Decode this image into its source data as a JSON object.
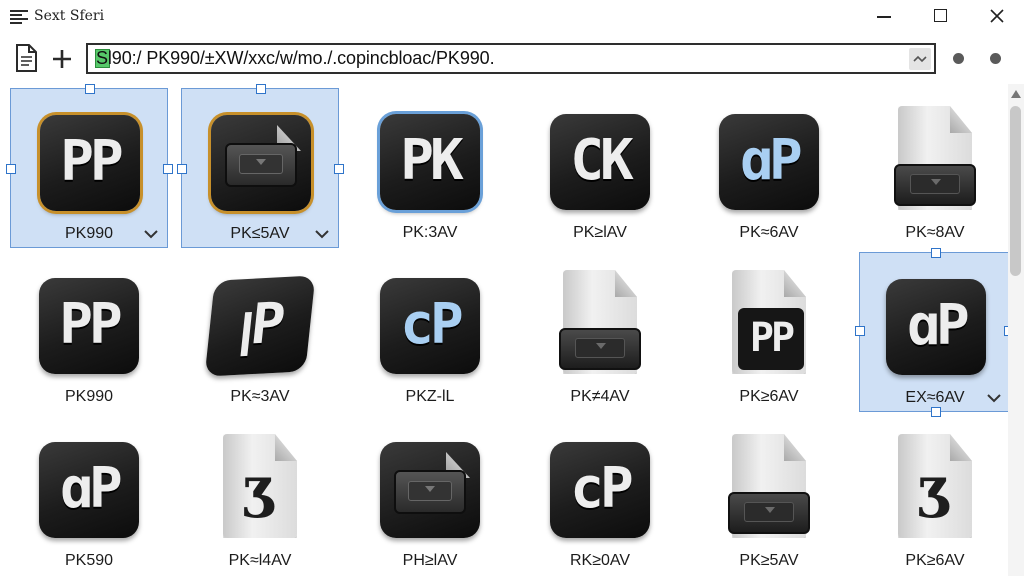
{
  "window": {
    "title": "Sext Sferi",
    "icons": {
      "app": "hamburger-menu-icon",
      "minimize": "minimize-icon",
      "maximize": "maximize-icon",
      "close": "close-icon"
    }
  },
  "toolbar": {
    "new_document_icon": "document-icon",
    "add_icon": "plus-icon",
    "address_value": "Sl90:/ PK990/±XW/xxc/w/mo./.copincbloac/PK990.",
    "dropdown_icon": "chevron-down-icon"
  },
  "colors": {
    "selection_fill": "#cfe0f5",
    "selection_border": "#6b9ad6",
    "handle_border": "#2f74c9",
    "orange_outline": "#c7902b",
    "blue_outline": "#6aa0d8",
    "address_badge": "#57c96a"
  },
  "items": [
    {
      "label": "PK990",
      "icon": "app-icon",
      "glyph": "PP",
      "selected": true,
      "dropdown": true
    },
    {
      "label": "PK≤5AV",
      "icon": "drive-icon",
      "glyph": "",
      "selected": true,
      "dropdown": true
    },
    {
      "label": "PK:3AV",
      "icon": "app-icon",
      "glyph": "PK",
      "selected": false,
      "dropdown": false
    },
    {
      "label": "PK≥lAV",
      "icon": "app-icon",
      "glyph": "CK",
      "selected": false,
      "dropdown": false
    },
    {
      "label": "PK≈6AV",
      "icon": "app-icon",
      "glyph": "ɑP",
      "selected": false,
      "dropdown": false
    },
    {
      "label": "PK≈8AV",
      "icon": "document-drive-icon",
      "glyph": "",
      "selected": false,
      "dropdown": false
    },
    {
      "label": "PK990",
      "icon": "app-icon",
      "glyph": "PP",
      "selected": false,
      "dropdown": false
    },
    {
      "label": "PK≈3AV",
      "icon": "app-icon",
      "glyph": "ꞁP",
      "selected": false,
      "dropdown": false
    },
    {
      "label": "PKZ-lL",
      "icon": "app-icon",
      "glyph": "cP",
      "selected": false,
      "dropdown": false
    },
    {
      "label": "PK≠4AV",
      "icon": "document-drive-icon",
      "glyph": "",
      "selected": false,
      "dropdown": false
    },
    {
      "label": "PK≥6AV",
      "icon": "document-app-icon",
      "glyph": "PP",
      "selected": false,
      "dropdown": false
    },
    {
      "label": "EX≈6AV",
      "icon": "app-icon",
      "glyph": "ɑP",
      "selected": true,
      "dropdown": true
    },
    {
      "label": "PK590",
      "icon": "app-icon",
      "glyph": "ɑP",
      "selected": false,
      "dropdown": false
    },
    {
      "label": "PK≈l4AV",
      "icon": "document-glyph-icon",
      "glyph": "Ʒ",
      "selected": false,
      "dropdown": false
    },
    {
      "label": "PH≥lAV",
      "icon": "drive-icon",
      "glyph": "",
      "selected": false,
      "dropdown": false
    },
    {
      "label": "RK≥0AV",
      "icon": "app-icon",
      "glyph": "cP",
      "selected": false,
      "dropdown": false
    },
    {
      "label": "PK≥5AV",
      "icon": "document-drive-icon",
      "glyph": "",
      "selected": false,
      "dropdown": false
    },
    {
      "label": "PK≥6AV",
      "icon": "document-glyph-icon",
      "glyph": "Ʒ",
      "selected": false,
      "dropdown": false
    }
  ],
  "scrollbar": {
    "up_icon": "scroll-up-arrow-icon"
  }
}
